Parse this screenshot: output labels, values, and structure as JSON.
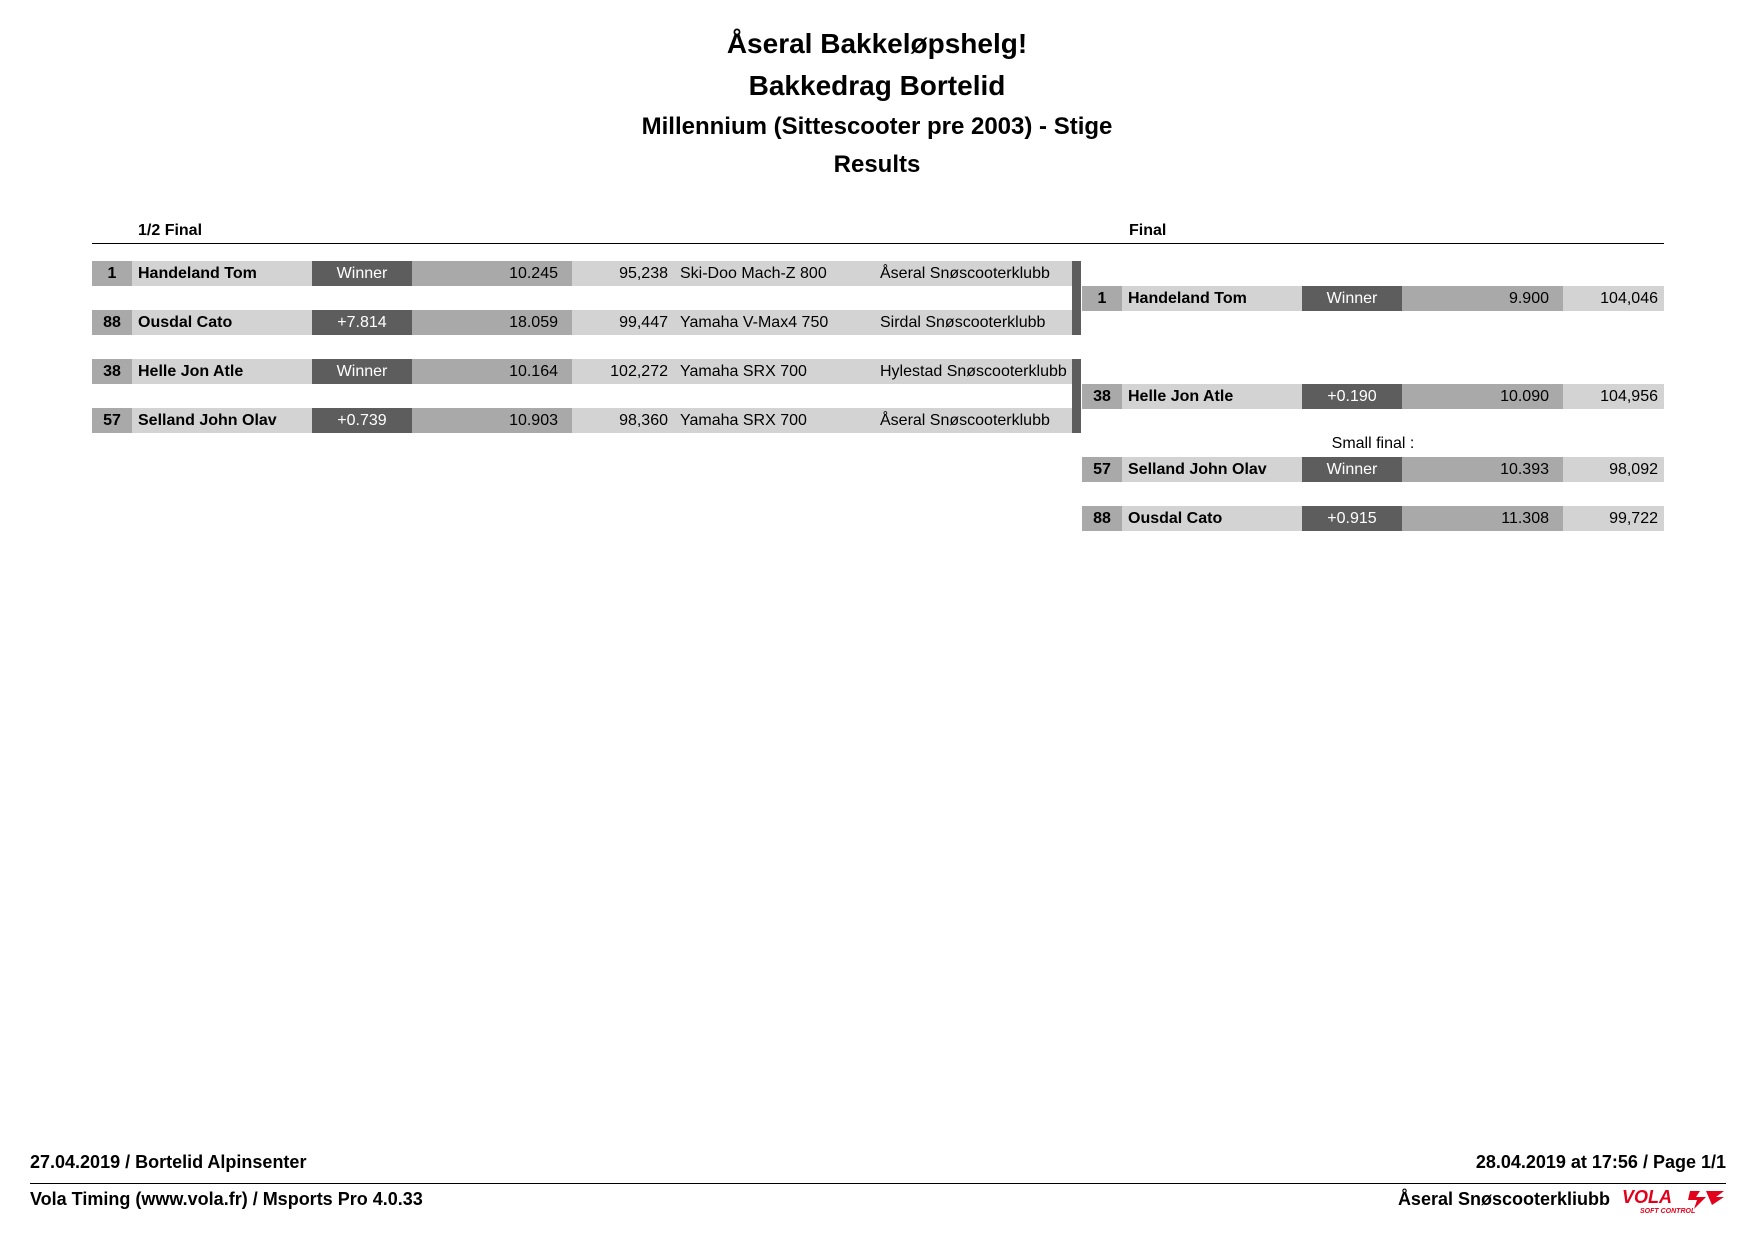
{
  "header": {
    "line1": "Åseral Bakkeløpshelg!",
    "line2": "Bakkedrag Bortelid",
    "line3": "Millennium (Sittescooter pre 2003) - Stige",
    "line4": "Results"
  },
  "semi": {
    "label": "1/2 Final",
    "rows": [
      {
        "num": "1",
        "name": "Handeland Tom",
        "result": "Winner",
        "time": "10.245",
        "speed": "95,238",
        "vehicle": "Ski-Doo Mach-Z 800",
        "club": "Åseral Snøscooterklubb"
      },
      {
        "num": "88",
        "name": "Ousdal Cato",
        "result": "+7.814",
        "time": "18.059",
        "speed": "99,447",
        "vehicle": "Yamaha V-Max4 750",
        "club": "Sirdal Snøscooterklubb"
      },
      {
        "num": "38",
        "name": "Helle Jon Atle",
        "result": "Winner",
        "time": "10.164",
        "speed": "102,272",
        "vehicle": "Yamaha SRX 700",
        "club": "Hylestad Snøscooterklubb"
      },
      {
        "num": "57",
        "name": "Selland John Olav",
        "result": "+0.739",
        "time": "10.903",
        "speed": "98,360",
        "vehicle": "Yamaha SRX 700",
        "club": "Åseral Snøscooterklubb"
      }
    ]
  },
  "final": {
    "label": "Final",
    "rows": [
      {
        "num": "1",
        "name": "Handeland Tom",
        "result": "Winner",
        "time": "9.900",
        "speed": "104,046"
      },
      {
        "num": "38",
        "name": "Helle Jon Atle",
        "result": "+0.190",
        "time": "10.090",
        "speed": "104,956"
      }
    ]
  },
  "small_final": {
    "label": "Small final :",
    "rows": [
      {
        "num": "57",
        "name": "Selland John Olav",
        "result": "Winner",
        "time": "10.393",
        "speed": "98,092"
      },
      {
        "num": "88",
        "name": "Ousdal Cato",
        "result": "+0.915",
        "time": "11.308",
        "speed": "99,722"
      }
    ]
  },
  "footer": {
    "left_top": "27.04.2019  /  Bortelid Alpinsenter",
    "right_top": "28.04.2019 at 17:56  /  Page 1/1",
    "left_bottom": "Vola Timing (www.vola.fr) / Msports Pro 4.0.33",
    "right_bottom": "Åseral Snøscooterkliubb",
    "logo_text": "VOLA",
    "logo_sub": "SOFT CONTROL",
    "logo_color": "#e2001a"
  }
}
